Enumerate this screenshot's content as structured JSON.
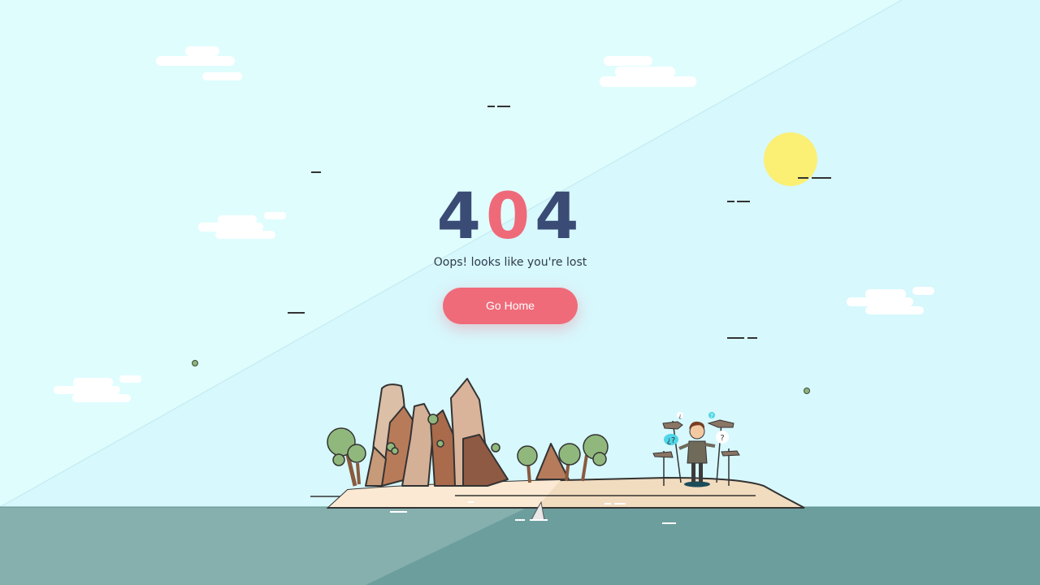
{
  "error": {
    "digit_1": "4",
    "digit_2": "0",
    "digit_3": "4"
  },
  "message": "Oops! looks like you're lost",
  "button": {
    "label": "Go Home"
  },
  "signposts": {
    "question_1": "¿",
    "question_2": "?",
    "question_3": "¿?",
    "question_4": "?"
  },
  "colors": {
    "sky": "#d6f8fd",
    "sea": "#6e9e9e",
    "title": "#3a4b75",
    "accent": "#f06b7a",
    "sun": "#fbef74",
    "sand": "#f1d9bd"
  }
}
